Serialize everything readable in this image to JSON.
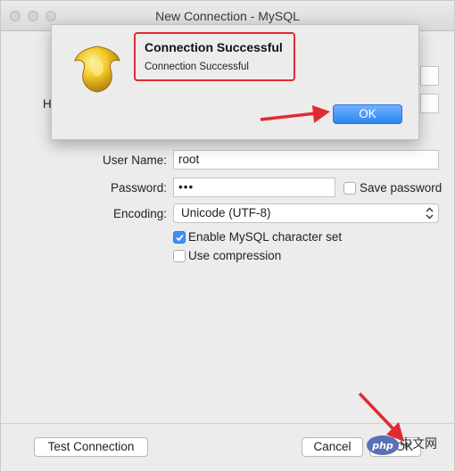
{
  "window": {
    "title": "New Connection - MySQL"
  },
  "form": {
    "hidden_label_initial": "H",
    "user_name_label": "User Name:",
    "user_name_value": "root",
    "password_label": "Password:",
    "password_value": "•••",
    "save_password_label": "Save password",
    "save_password_checked": false,
    "encoding_label": "Encoding:",
    "encoding_value": "Unicode (UTF-8)",
    "enable_charset_label": "Enable MySQL character set",
    "enable_charset_checked": true,
    "compression_label": "Use compression",
    "compression_checked": false
  },
  "buttons": {
    "test_connection": "Test Connection",
    "cancel": "Cancel",
    "ok_partial": "OK"
  },
  "alert": {
    "title": "Connection Successful",
    "message": "Connection Successful",
    "ok_label": "OK",
    "icon": "navicat-logo-icon"
  },
  "watermark": {
    "text": "中文网",
    "logo": "php-logo"
  },
  "colors": {
    "accent_blue": "#3d8ff5",
    "annotation_red": "#e02b30",
    "window_bg": "#ececec"
  }
}
